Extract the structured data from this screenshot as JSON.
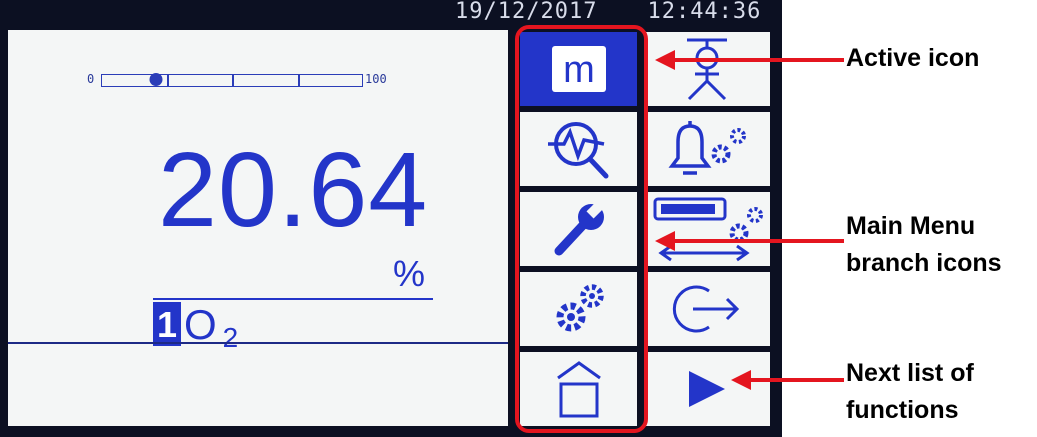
{
  "header": {
    "date": "19/12/2017",
    "time": "12:44:36"
  },
  "reading": {
    "value": "20.64",
    "unit": "%",
    "channel": "1",
    "gas": "O",
    "gas_subscript": "2",
    "range_min": "0",
    "range_max": "100",
    "range_fraction": 0.2064
  },
  "menu": {
    "tiles": [
      {
        "icon": "measure-m-icon",
        "label": "m",
        "active": true
      },
      {
        "icon": "operator-person-icon",
        "active": false
      },
      {
        "icon": "trend-zoom-icon",
        "active": false
      },
      {
        "icon": "alarm-settings-icon",
        "active": false
      },
      {
        "icon": "wrench-icon",
        "active": false
      },
      {
        "icon": "output-settings-icon",
        "active": false
      },
      {
        "icon": "settings-gears-icon",
        "active": false
      },
      {
        "icon": "logout-icon",
        "active": false
      },
      {
        "icon": "home-icon",
        "active": false
      },
      {
        "icon": "next-arrow-icon",
        "active": false
      }
    ]
  },
  "annotations": {
    "active_icon": "Active icon",
    "main_menu_line1": "Main Menu",
    "main_menu_line2": "branch icons",
    "next_list_line1": "Next list of",
    "next_list_line2": "functions"
  },
  "colors": {
    "screen_blue": "#2335c9",
    "highlight_red": "#e4151f",
    "panel_bg": "#f4f6f6"
  }
}
